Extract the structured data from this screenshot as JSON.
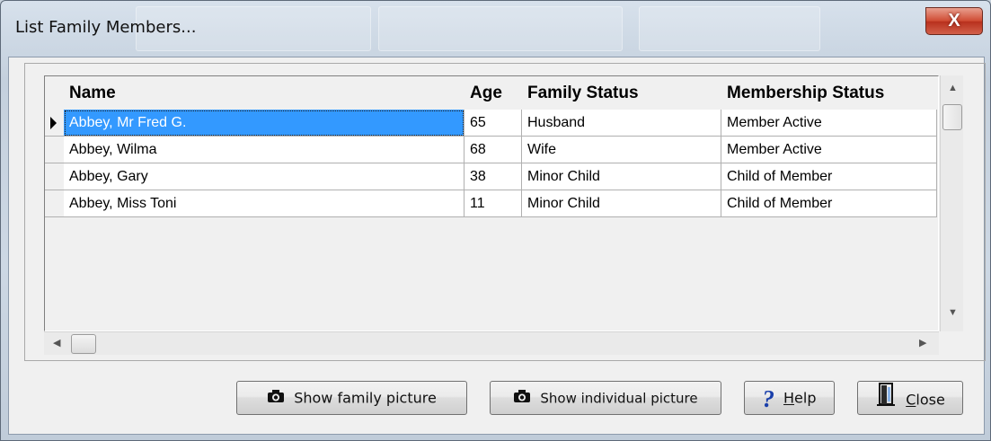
{
  "window": {
    "title": "List Family Members...",
    "close_glyph": "X"
  },
  "grid": {
    "columns": [
      "Name",
      "Age",
      "Family Status",
      "Membership Status"
    ],
    "rows": [
      {
        "name": "Abbey, Mr Fred G.",
        "age": "65",
        "family_status": "Husband",
        "membership_status": "Member Active",
        "selected": true
      },
      {
        "name": "Abbey, Wilma",
        "age": "68",
        "family_status": "Wife",
        "membership_status": "Member Active",
        "selected": false
      },
      {
        "name": "Abbey, Gary",
        "age": "38",
        "family_status": "Minor Child",
        "membership_status": "Child of Member",
        "selected": false
      },
      {
        "name": "Abbey, Miss Toni",
        "age": "11",
        "family_status": "Minor Child",
        "membership_status": "Child of Member",
        "selected": false
      }
    ],
    "row_indicator_icon": "current-row-arrow-icon"
  },
  "buttons": {
    "show_family": {
      "label": "Show family picture",
      "icon": "camera-icon"
    },
    "show_individual": {
      "label": "Show individual picture",
      "icon": "camera-icon"
    },
    "help": {
      "label_first": "H",
      "label_rest": "elp",
      "icon": "question-icon"
    },
    "close": {
      "label_first": "C",
      "label_rest": "lose",
      "icon": "door-exit-icon"
    }
  },
  "colors": {
    "selection": "#3399ff",
    "close_button": "#c9442d",
    "help_icon": "#1a3faa"
  }
}
